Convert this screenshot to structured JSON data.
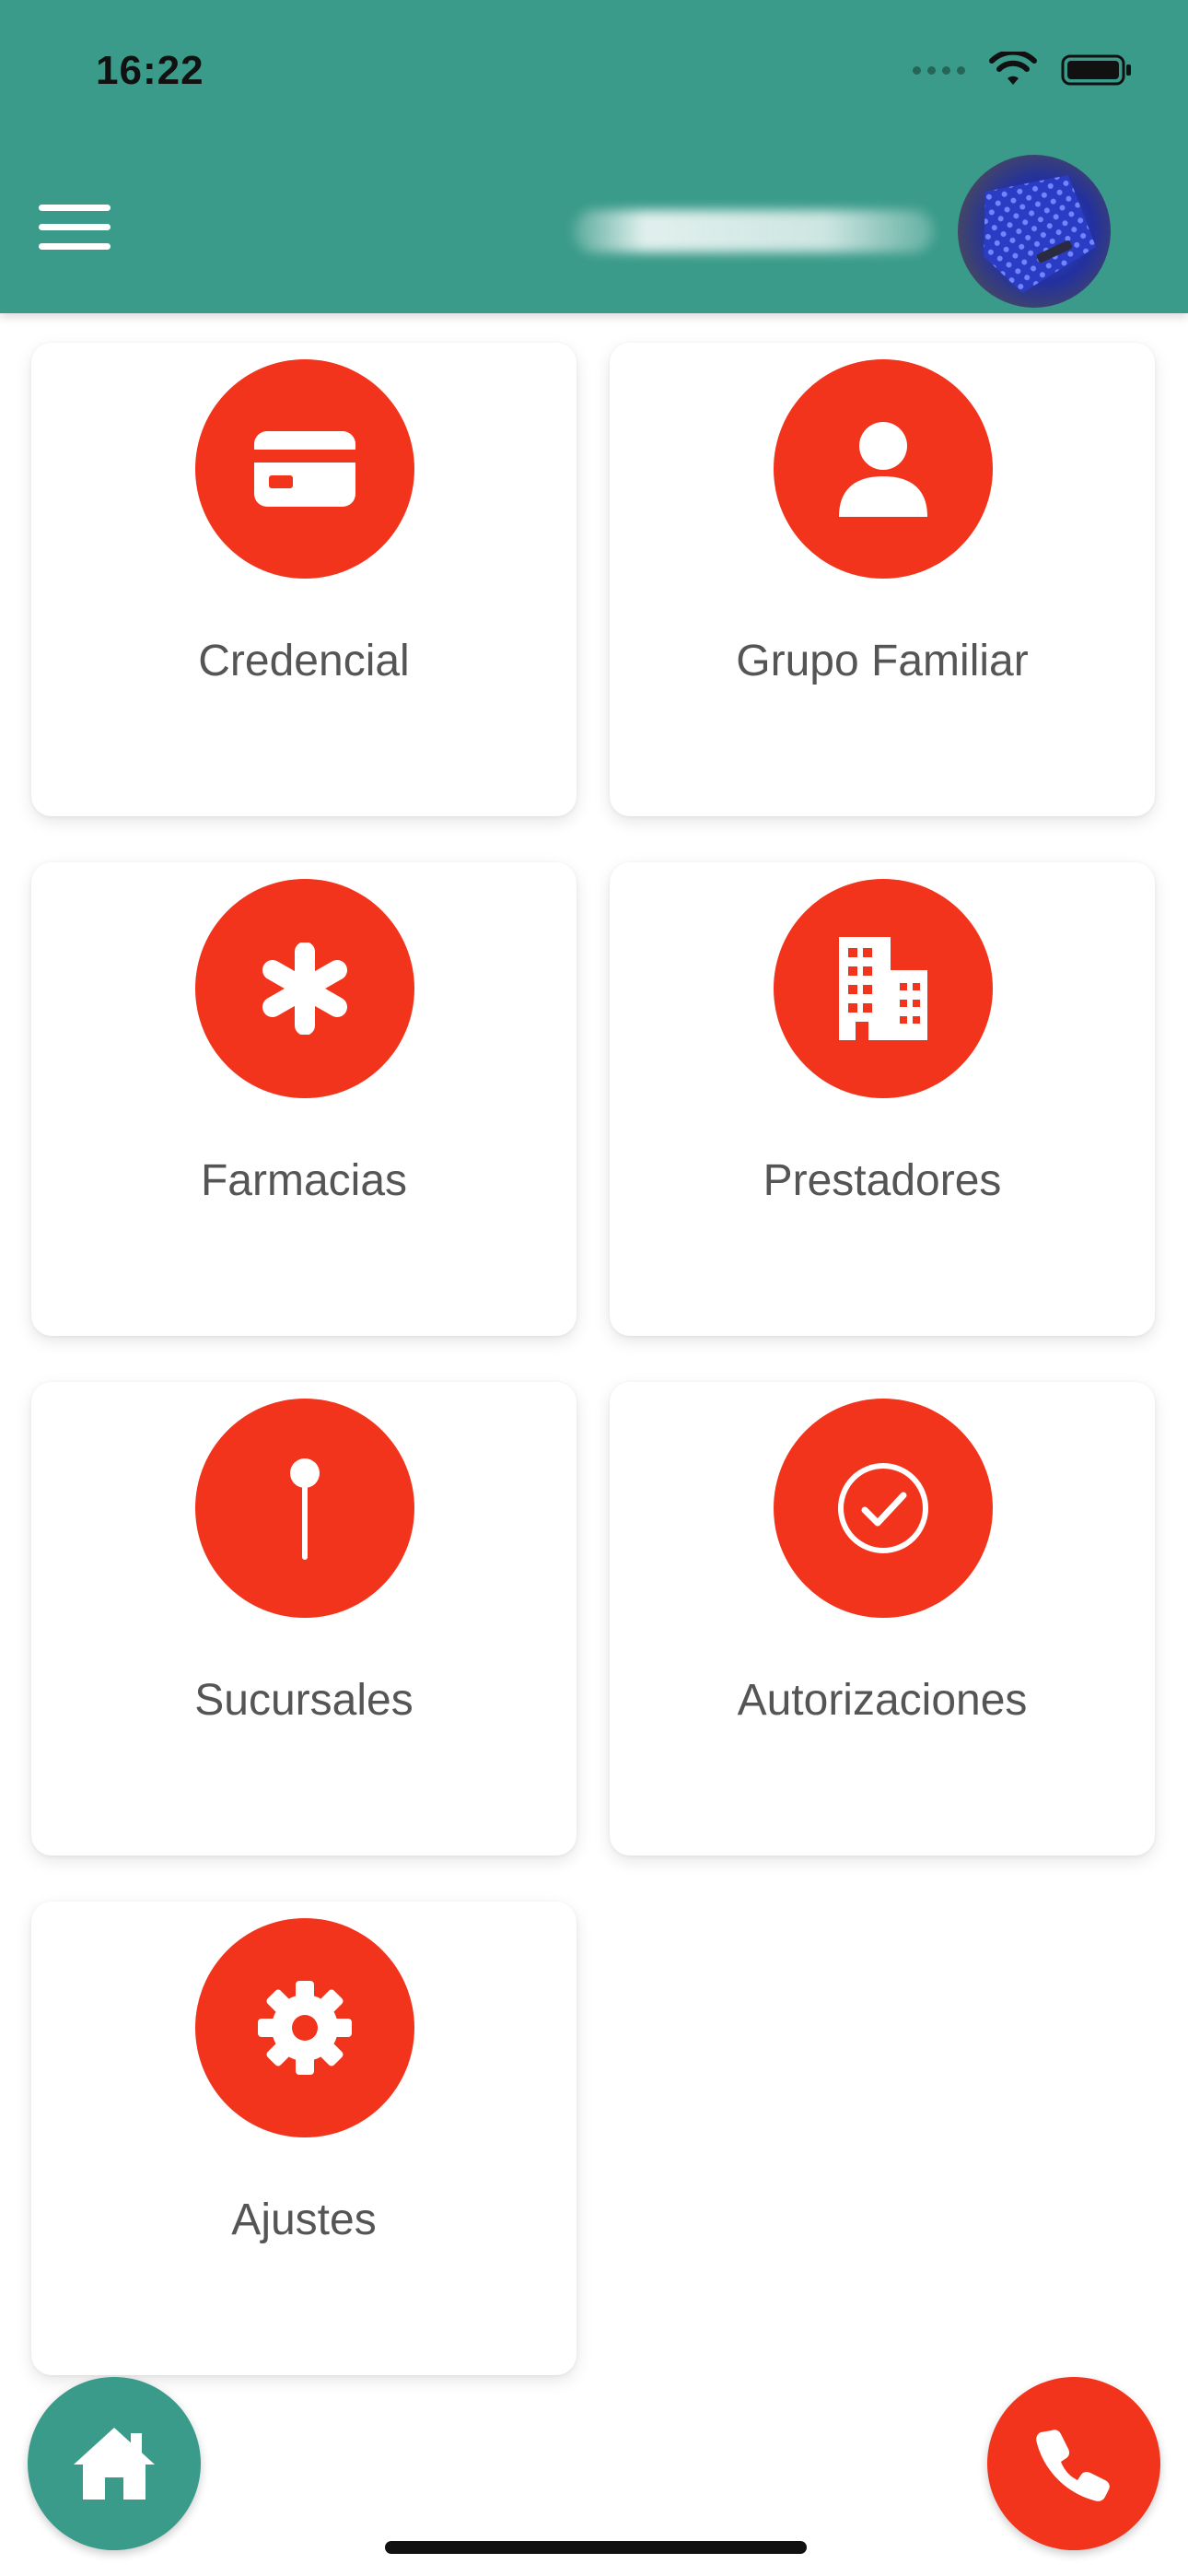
{
  "status_bar": {
    "time": "16:22",
    "icons": [
      "cellular-signal-icon",
      "wifi-icon",
      "battery-icon"
    ]
  },
  "header": {
    "menu_icon": "hamburger-menu-icon",
    "avatar_icon": "user-avatar"
  },
  "menu": {
    "items": [
      {
        "label": "Credencial",
        "icon": "id-card-icon"
      },
      {
        "label": "Grupo Familiar",
        "icon": "user-icon"
      },
      {
        "label": "Farmacias",
        "icon": "asterisk-icon"
      },
      {
        "label": "Prestadores",
        "icon": "building-icon"
      },
      {
        "label": "Sucursales",
        "icon": "map-pin-icon"
      },
      {
        "label": "Autorizaciones",
        "icon": "check-circle-icon"
      },
      {
        "label": "Ajustes",
        "icon": "gear-icon"
      }
    ]
  },
  "bottom": {
    "home_icon": "home-icon",
    "call_icon": "phone-icon"
  },
  "colors": {
    "header": "#3a9b8a",
    "accent": "#f2341c",
    "label": "#555555",
    "card": "#ffffff"
  }
}
